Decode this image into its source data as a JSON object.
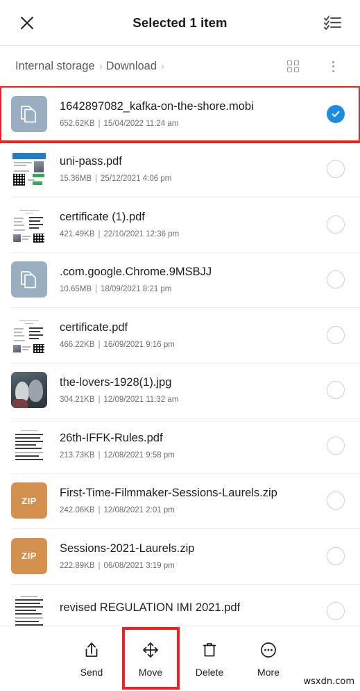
{
  "appbar": {
    "close_icon": "close-icon",
    "title": "Selected 1 item",
    "select_all_icon": "select-all-checklist-icon"
  },
  "breadcrumb": {
    "items": [
      {
        "label": "Internal storage"
      },
      {
        "label": "Download"
      }
    ],
    "separator": "›",
    "grid_view_icon": "grid-view-icon",
    "overflow_icon": "overflow-menu-icon"
  },
  "files": [
    {
      "name": "1642897082_kafka-on-the-shore.mobi",
      "size": "652.62KB",
      "date": "15/04/2022 11:24 am",
      "kind": "generic",
      "selected": true,
      "highlighted": true
    },
    {
      "name": "uni-pass.pdf",
      "size": "15.36MB",
      "date": "25/12/2021 4:06 pm",
      "kind": "pdf-pass",
      "selected": false,
      "highlighted": false
    },
    {
      "name": "certificate (1).pdf",
      "size": "421.49KB",
      "date": "22/10/2021 12:36 pm",
      "kind": "pdf-cert",
      "selected": false,
      "highlighted": false
    },
    {
      "name": ".com.google.Chrome.9MSBJJ",
      "size": "10.65MB",
      "date": "18/09/2021 8:21 pm",
      "kind": "generic",
      "selected": false,
      "highlighted": false
    },
    {
      "name": "certificate.pdf",
      "size": "466.22KB",
      "date": "16/09/2021 9:16 pm",
      "kind": "pdf-cert",
      "selected": false,
      "highlighted": false
    },
    {
      "name": "the-lovers-1928(1).jpg",
      "size": "304.21KB",
      "date": "12/09/2021 11:32 am",
      "kind": "image-lovers",
      "selected": false,
      "highlighted": false
    },
    {
      "name": "26th-IFFK-Rules.pdf",
      "size": "213.73KB",
      "date": "12/08/2021 9:58 pm",
      "kind": "pdf-text",
      "selected": false,
      "highlighted": false
    },
    {
      "name": "First-Time-Filmmaker-Sessions-Laurels.zip",
      "size": "242.06KB",
      "date": "12/08/2021 2:01 pm",
      "kind": "zip",
      "zip_label": "ZIP",
      "selected": false,
      "highlighted": false
    },
    {
      "name": "Sessions-2021-Laurels.zip",
      "size": "222.89KB",
      "date": "06/08/2021 3:19 pm",
      "kind": "zip",
      "zip_label": "ZIP",
      "selected": false,
      "highlighted": false
    },
    {
      "name": "revised REGULATION IMI 2021.pdf",
      "size": "",
      "date": "",
      "kind": "pdf-text",
      "selected": false,
      "highlighted": false
    }
  ],
  "separator_bar": "|",
  "toolbar": {
    "items": [
      {
        "label": "Send",
        "icon": "share-upload-icon",
        "highlighted": false
      },
      {
        "label": "Move",
        "icon": "move-arrows-icon",
        "highlighted": true
      },
      {
        "label": "Delete",
        "icon": "trash-icon",
        "highlighted": false
      },
      {
        "label": "More",
        "icon": "more-ellipsis-circle-icon",
        "highlighted": false
      }
    ]
  },
  "watermark": "wsxdn.com",
  "colors": {
    "accent_blue": "#1b8ce6",
    "highlight_red": "#ee2222",
    "zip_orange": "#d4904f",
    "generic_file_blue": "#9aaec1"
  }
}
